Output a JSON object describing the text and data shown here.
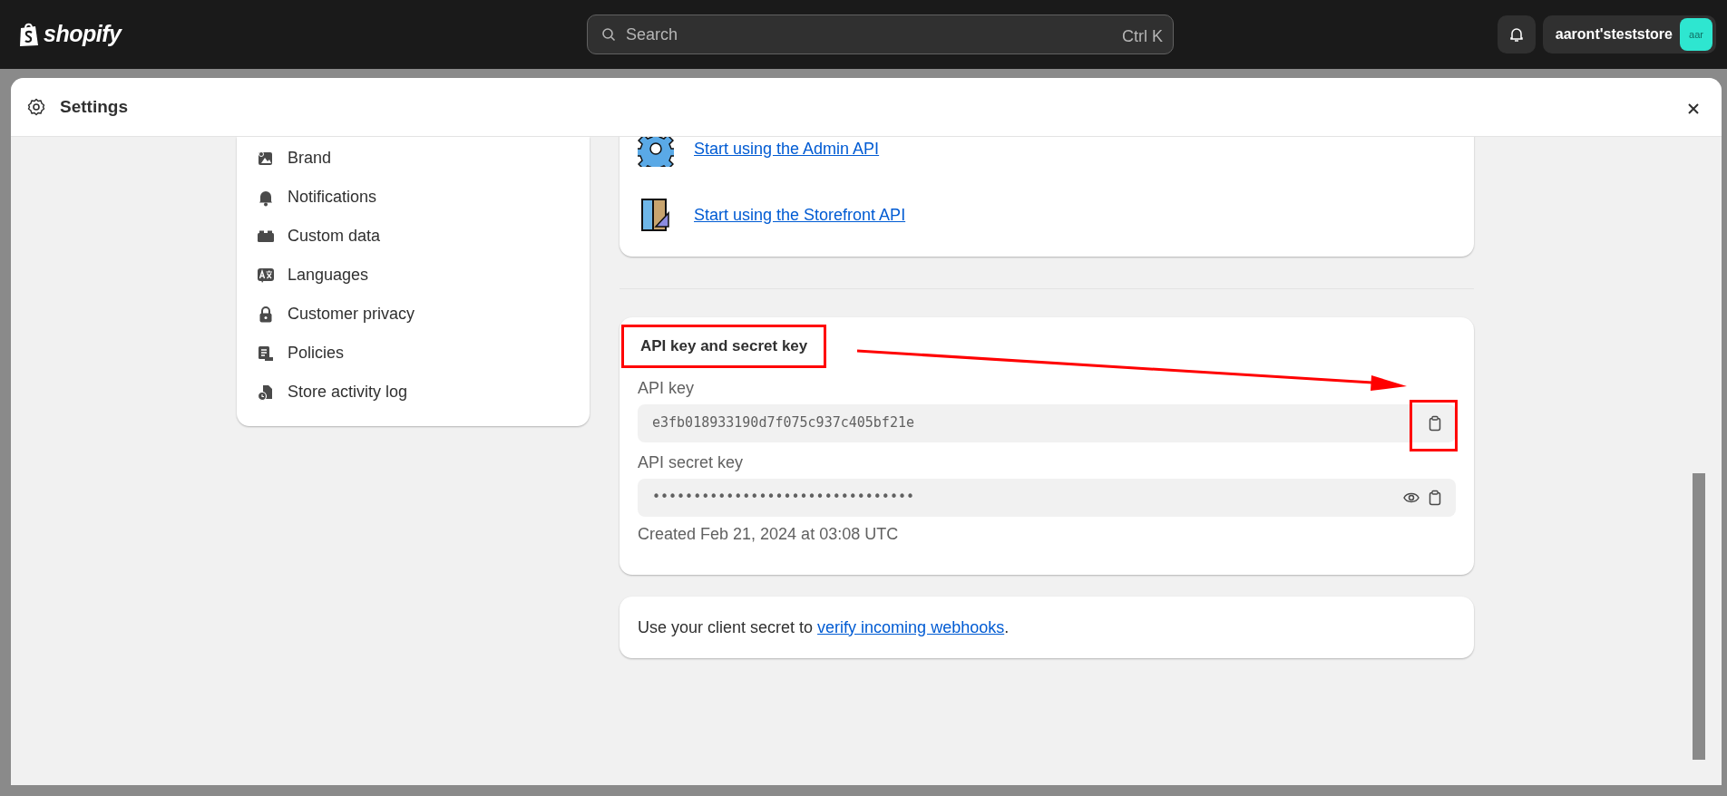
{
  "topbar": {
    "logo": "shopify",
    "search": {
      "placeholder": "Search",
      "shortcut": "Ctrl K"
    },
    "store": {
      "name": "aaront'steststore",
      "avatar": "aar"
    }
  },
  "modal": {
    "title": "Settings"
  },
  "sidebar": {
    "items": [
      {
        "label": "Brand"
      },
      {
        "label": "Notifications"
      },
      {
        "label": "Custom data"
      },
      {
        "label": "Languages"
      },
      {
        "label": "Customer privacy"
      },
      {
        "label": "Policies"
      },
      {
        "label": "Store activity log"
      }
    ]
  },
  "api_links": [
    {
      "label": "Start using the Admin API"
    },
    {
      "label": "Start using the Storefront API"
    }
  ],
  "api_card": {
    "title": "API key and secret key",
    "fields": [
      {
        "label": "API key",
        "value": "e3fb018933190d7f075c937c405bf21e",
        "masked": false
      },
      {
        "label": "API secret key",
        "value": "••••••••••••••••••••••••••••••••",
        "masked": true
      }
    ],
    "created": "Created Feb 21, 2024 at 03:08 UTC"
  },
  "webhook_note": {
    "before": "Use your client secret to ",
    "link": "verify incoming webhooks",
    "after": "."
  }
}
